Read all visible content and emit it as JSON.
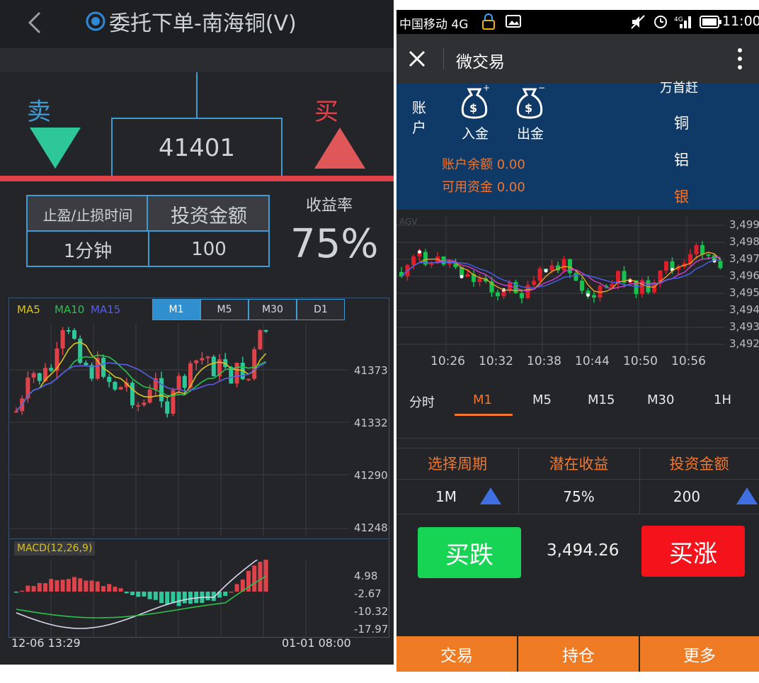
{
  "left": {
    "title": "委托下单-南海铜(V)",
    "sell_label": "卖",
    "buy_label": "买",
    "price": "41401",
    "table": {
      "head_time": "止盈/止损时间",
      "head_amount": "投资金额",
      "val_time": "1分钟",
      "val_amount": "100"
    },
    "yield_label": "收益率",
    "yield_value": "75%",
    "ma_labels": [
      "MA5",
      "MA10",
      "MA15"
    ],
    "tabs": [
      "M1",
      "M5",
      "M30",
      "D1"
    ],
    "active_tab": "M1",
    "price_axis": [
      "41373",
      "41332",
      "41290",
      "41248"
    ],
    "macd_label": "MACD(12,26,9)",
    "macd_axis": [
      "4.98",
      "-2.67",
      "-10.32",
      "-17.97"
    ],
    "time_start": "12-06 13:29",
    "time_end": "01-01 08:00",
    "colors": {
      "up": "#e0424a",
      "down": "#2ec79a",
      "ma5": "#d8c21f",
      "ma10": "#29c24c",
      "ma15": "#5b5de6",
      "accent": "#3f9bd4"
    }
  },
  "right": {
    "status": {
      "carrier": "中国移动 4G",
      "time": "11:00"
    },
    "header_title": "微交易",
    "account": {
      "label": "账户",
      "deposit": "入金",
      "withdraw": "出金",
      "balance": "账户余额 0.00",
      "available": "可用资金 0.00",
      "tips_cut": "万首赶"
    },
    "metals": [
      "铜",
      "铝",
      "银"
    ],
    "active_metal": "银",
    "chart_tag": "AGV",
    "price_axis": [
      "3,499",
      "3,498",
      "3,497",
      "3,496",
      "3,495",
      "3,494",
      "3,493",
      "3,492"
    ],
    "time_axis": [
      "10:26",
      "10:32",
      "10:38",
      "10:44",
      "10:50",
      "10:56"
    ],
    "period_tabs": [
      "分时",
      "M1",
      "M5",
      "M15",
      "M30",
      "1H"
    ],
    "active_period": "M1",
    "form": {
      "head_period": "选择周期",
      "head_profit": "潜在收益",
      "head_amount": "投资金额",
      "val_period": "1M",
      "val_profit": "75%",
      "val_amount": "200"
    },
    "buy_down": "买跌",
    "buy_up": "买涨",
    "current_price": "3,494.26",
    "bottom_nav": [
      "交易",
      "持仓",
      "更多"
    ],
    "colors": {
      "navy": "#0f3a68",
      "orange": "#f2762d",
      "green": "#17d455",
      "red": "#f4121b"
    }
  }
}
